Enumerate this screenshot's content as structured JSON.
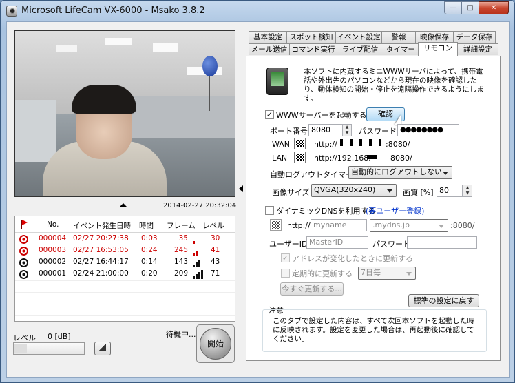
{
  "window": {
    "title": "Microsoft LifeCam VX-6000 - Msako 3.8.2",
    "minimize_glyph": "—",
    "maximize_glyph": "□",
    "close_glyph": "✕"
  },
  "video": {
    "timestamp": "2014-02-27 20:32:04"
  },
  "event_table": {
    "headers": [
      "No.",
      "イベント発生日時",
      "時間",
      "フレーム",
      "レベル"
    ],
    "rows": [
      {
        "no": "000004",
        "datetime": "02/27 20:27:38",
        "duration": "0:03",
        "frames": "35",
        "level": "30",
        "unread": true,
        "level_bars": 1
      },
      {
        "no": "000003",
        "datetime": "02/27 16:53:05",
        "duration": "0:24",
        "frames": "245",
        "level": "41",
        "unread": true,
        "level_bars": 2
      },
      {
        "no": "000002",
        "datetime": "02/27 16:44:17",
        "duration": "0:14",
        "frames": "143",
        "level": "43",
        "unread": false,
        "level_bars": 3
      },
      {
        "no": "000001",
        "datetime": "02/24 21:00:00",
        "duration": "0:20",
        "frames": "209",
        "level": "71",
        "unread": false,
        "level_bars": 4
      }
    ]
  },
  "level_meter": {
    "label": "レベル",
    "value": "0 [dB]"
  },
  "status": {
    "text": "待機中...",
    "start_button": "開始"
  },
  "tabs": {
    "row1": [
      "基本設定",
      "スポット検知",
      "イベント設定",
      "警報",
      "映像保存",
      "データ保存"
    ],
    "row2": [
      "メール送信",
      "コマンド実行",
      "ライブ配信",
      "タイマー",
      "リモコン",
      "詳細設定"
    ],
    "active": "リモコン"
  },
  "remote": {
    "description": "本ソフトに内蔵するミニWWWサーバによって、携帯電話や外出先のパソコンなどから現在の映像を確認したり、動体検知の開始・停止を遠隔操作できるようにします。",
    "www_server_label": "WWWサーバーを起動する",
    "www_server_checked": true,
    "confirm_button": "確認",
    "port_label": "ポート番号",
    "port_value": "8080",
    "password_label": "パスワード",
    "password_mask": "●●●●●●●●",
    "wan_label": "WAN",
    "wan_url_prefix": "http://",
    "wan_url_suffix": ":8080/",
    "lan_label": "LAN",
    "lan_url_prefix": "http://192.168.",
    "lan_url_suffix": "8080/",
    "logout_label": "自動ログアウトタイマー",
    "logout_value": "自動的にログアウトしない",
    "image_size_label": "画像サイズ",
    "image_size_value": "QVGA(320x240)",
    "quality_label": "画質 [%]",
    "quality_value": "80"
  },
  "dyndns": {
    "label": "ダイナミックDNSを利用する",
    "checked": false,
    "register_link": "(要ユーザー登録)",
    "http_prefix": "http://",
    "host_placeholder": "myname",
    "domain_value": ".mydns.jp",
    "port_suffix": ":8080/",
    "user_id_label": "ユーザーID",
    "user_id_placeholder": "MasterID",
    "password_label": "パスワード",
    "update_on_change": "アドレスが変化したときに更新する",
    "update_periodic": "定期的に更新する",
    "period_value": "7日毎",
    "update_now_button": "今すぐ更新する..."
  },
  "reset_button": "標準の設定に戻す",
  "note": {
    "title": "注意",
    "text": "このタブで設定した内容は、すべて次回本ソフトを起動した時に反映されます。設定を変更した場合は、再起動後に確認してください。"
  },
  "colors": {
    "accent_red": "#cc0000",
    "link_blue": "#0033cc",
    "title_bar": "#a9c3e0"
  }
}
